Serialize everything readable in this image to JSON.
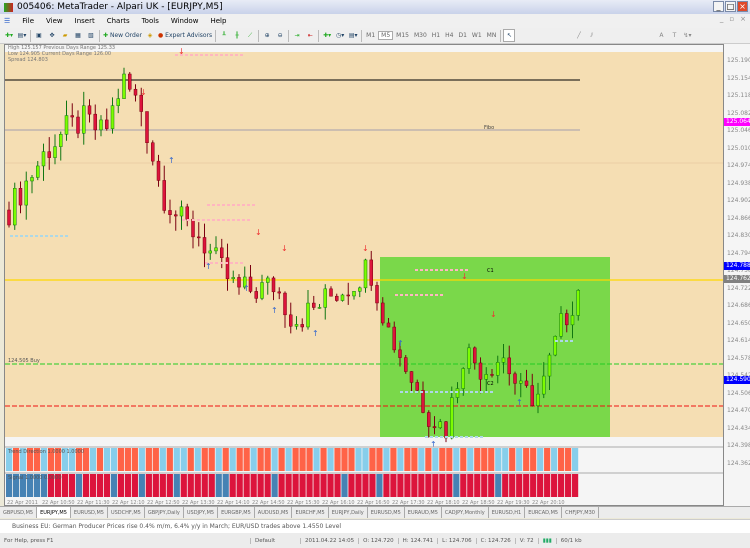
{
  "window": {
    "title": "005406: MetaTrader - Alpari UK - [EURJPY,M5]"
  },
  "menu": [
    "File",
    "View",
    "Insert",
    "Charts",
    "Tools",
    "Window",
    "Help"
  ],
  "toolbar": {
    "new_order": "New Order",
    "expert_advisors": "Expert Advisors",
    "timeframes": [
      "M1",
      "M5",
      "M15",
      "M30",
      "H1",
      "H4",
      "D1",
      "W1",
      "MN"
    ],
    "active_timeframe": "M5"
  },
  "chart": {
    "symbol": "EURJPY,M5",
    "info_lines": [
      "High  125.157   Previous Days Range  125.33",
      "Low   124.905   Current Days Range   126.00",
      "Spread  124.803"
    ],
    "level_labels": {
      "fibo": "Fibo",
      "c1": "C1",
      "c2": "C2",
      "green_level": "124.505 Buy"
    },
    "price_ticks": [
      "125.190",
      "125.154",
      "125.118",
      "125.082",
      "125.046",
      "125.010",
      "124.974",
      "124.938",
      "124.902",
      "124.866",
      "124.830",
      "124.794",
      "124.758",
      "124.722",
      "124.686",
      "124.650",
      "124.614",
      "124.578",
      "124.542",
      "124.506",
      "124.470",
      "124.434",
      "124.398",
      "124.362"
    ],
    "price_tags": [
      {
        "text": "125.064",
        "color": "#ff00ff"
      },
      {
        "text": "124.788",
        "color": "#0000ff"
      },
      {
        "text": "124.762",
        "color": "#808080"
      },
      {
        "text": "124.590",
        "color": "#0000ff"
      }
    ],
    "colors": {
      "background": "#f5deb3",
      "bull": "#7cfc00",
      "bear": "#dc143c",
      "box": "#7ad84a",
      "gold": "#ffd700"
    },
    "close_keypoints": [
      124.89,
      124.95,
      125.01,
      125.05,
      125.07,
      125.04,
      125.15,
      125.09,
      124.93,
      124.87,
      124.84,
      124.78,
      124.73,
      124.73,
      124.74,
      124.67,
      124.69,
      124.72,
      124.74,
      124.78,
      124.65,
      124.57,
      124.49,
      124.45,
      124.61,
      124.57,
      124.6,
      124.52,
      124.52,
      124.65,
      124.73
    ]
  },
  "indicators": [
    {
      "label": "Trend Direction  1.0000  1.0000"
    },
    {
      "label": "Signal  1.0000  0.0000"
    }
  ],
  "indicator_pattern": [
    "0101101100110100111011010010110101101101011101011100110101101011010111001011010110",
    "0000001111011110111011110111110011111101111111110111101111111111011111011111111111"
  ],
  "time_ticks": [
    "22 Apr 2011",
    "22 Apr 10:50",
    "22 Apr 11:30",
    "22 Apr 12:10",
    "22 Apr 12:50",
    "22 Apr 13:30",
    "22 Apr 14:10",
    "22 Apr 14:50",
    "22 Apr 15:30",
    "22 Apr 16:10",
    "22 Apr 16:50",
    "22 Apr 17:30",
    "22 Apr 18:10",
    "22 Apr 18:50",
    "22 Apr 19:30",
    "22 Apr 20:10"
  ],
  "tabs": [
    "GBPUSD,M5",
    "EURJPY,M5",
    "EURUSD,M5",
    "USDCHF,M5",
    "GBPJPY,Daily",
    "USDJPY,M5",
    "EURGBP,M5",
    "AUDUSD,M5",
    "EURCHF,M5",
    "EURJPY,Daily",
    "EURUSD,M5",
    "EURAUD,M5",
    "CADJPY,Monthly",
    "EURUSD,H1",
    "EURCAD,M5",
    "CHFJPY,M30"
  ],
  "active_tab": 1,
  "news": "Business  EU: German Producer Prices rise 0.4% m/m, 6.4% y/y in March; EUR/USD trades above 1.4550 Level",
  "status": {
    "help": "For Help, press F1",
    "profile": "Default",
    "datetime": "2011.04.22 14:05",
    "open": "O: 124.720",
    "high": "H: 124.741",
    "low": "L: 124.706",
    "close": "C: 124.726",
    "volume": "V: 72",
    "traffic": "60/1 kb"
  }
}
